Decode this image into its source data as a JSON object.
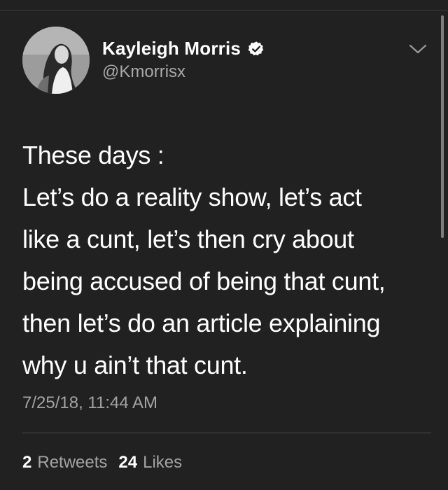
{
  "author": {
    "display_name": "Kayleigh Morris",
    "handle": "@Kmorrisx",
    "verified": true
  },
  "tweet": {
    "lines": [
      "These days :",
      "Let’s do a reality show, let’s act",
      "like a cunt, let’s then cry about",
      "being accused of being that cunt,",
      "then let’s do an article explaining",
      "why u ain’t that cunt."
    ],
    "timestamp": "7/25/18, 11:44 AM"
  },
  "stats": {
    "retweets_count": "2",
    "retweets_label": "Retweets",
    "likes_count": "24",
    "likes_label": "Likes"
  },
  "icons": {
    "verified": "verified-badge-icon",
    "menu": "chevron-down-icon"
  },
  "colors": {
    "background": "#212121",
    "primary_text": "#ffffff",
    "secondary_text": "#a3a3a3"
  }
}
